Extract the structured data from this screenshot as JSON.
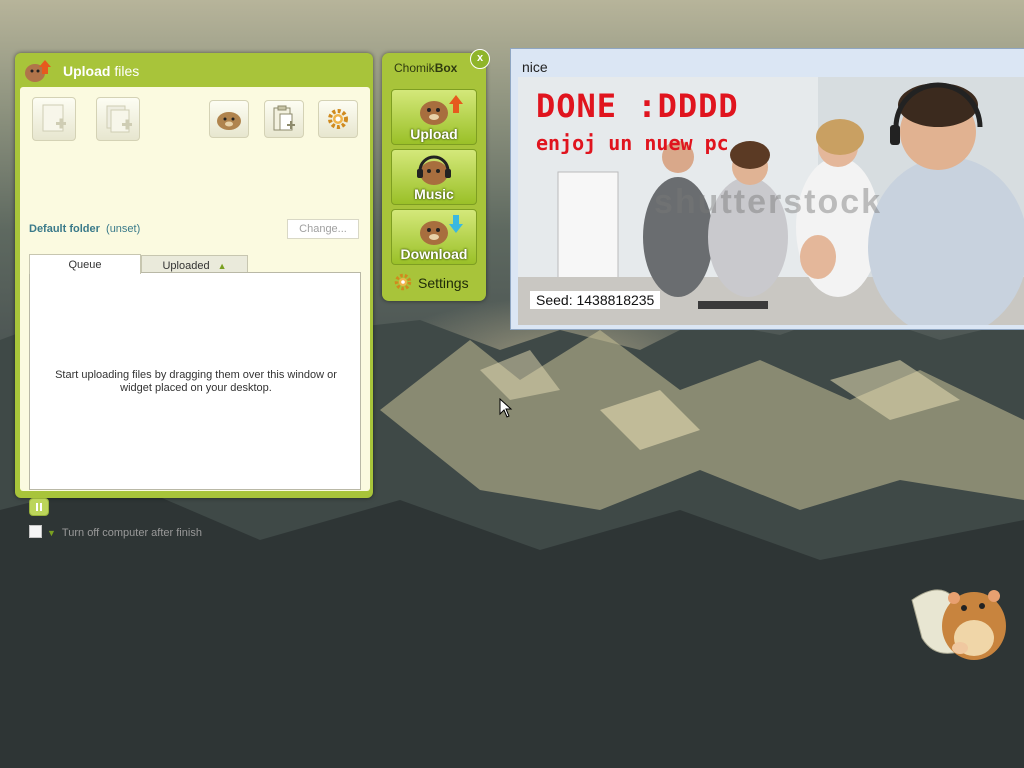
{
  "upload_window": {
    "title_bold": "Upload",
    "title_rest": " files",
    "default_folder_label": "Default folder",
    "default_folder_value": "(unset)",
    "change_button": "Change...",
    "tabs": [
      "Queue",
      "Uploaded"
    ],
    "queue_message": "Start uploading files by dragging them over this window or widget placed on your desktop.",
    "turn_off_label": "Turn off computer after finish"
  },
  "chomikbox": {
    "title_regular": "Chomik",
    "title_bold": "Box",
    "close": "x",
    "buttons": [
      "Upload",
      "Music",
      "Download"
    ],
    "settings": "Settings"
  },
  "nice_window": {
    "title": "nice",
    "headline": "DONE :DDDD",
    "subline": "enjoj un nuew pc",
    "watermark": "shutterstock",
    "seed": "Seed: 1438818235"
  },
  "colors": {
    "widget_green": "#a8c43a",
    "panel_cream": "#fbfae0",
    "headline_red": "#e0141e"
  }
}
